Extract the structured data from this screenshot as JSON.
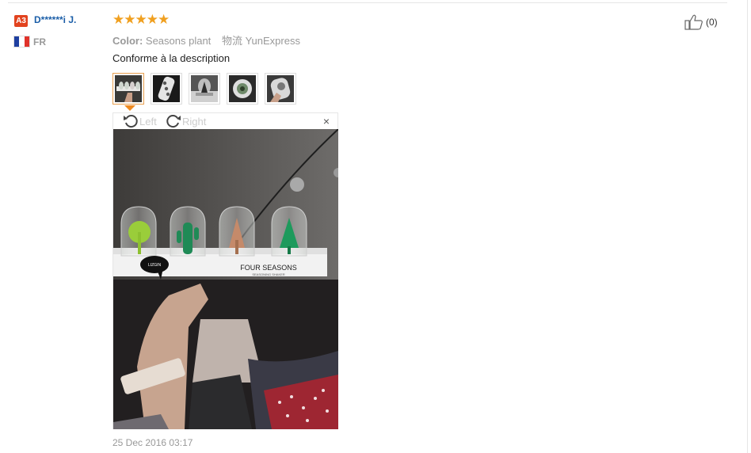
{
  "reviewer": {
    "level_badge": "A3",
    "name": "D******i J.",
    "country": "FR",
    "flag_colors": [
      "#1f3fa0",
      "#ffffff",
      "#e0322a"
    ]
  },
  "review": {
    "rating_stars": "★★★★★",
    "rating_value": 5,
    "color_label": "Color:",
    "color_value": "Seasons plant",
    "logistics_label": "物流",
    "logistics_value": "YunExpress",
    "text": "Conforme à la description",
    "date": "25 Dec 2016 03:17",
    "star_color": "#f0a020"
  },
  "helpful": {
    "icon": "thumbs-up-icon",
    "count": "(0)"
  },
  "thumbnails": [
    {
      "name": "photo-1",
      "selected": true
    },
    {
      "name": "photo-2",
      "selected": false
    },
    {
      "name": "photo-3",
      "selected": false
    },
    {
      "name": "photo-4",
      "selected": false
    },
    {
      "name": "photo-5",
      "selected": false
    }
  ],
  "viewer": {
    "rotate_left_label": "Left",
    "rotate_right_label": "Right",
    "close_label": "×",
    "photo_caption": "FOUR SEASONS",
    "photo_subcaption": "SEASONING SHAKER",
    "photo_brand": "LIZGIN"
  }
}
